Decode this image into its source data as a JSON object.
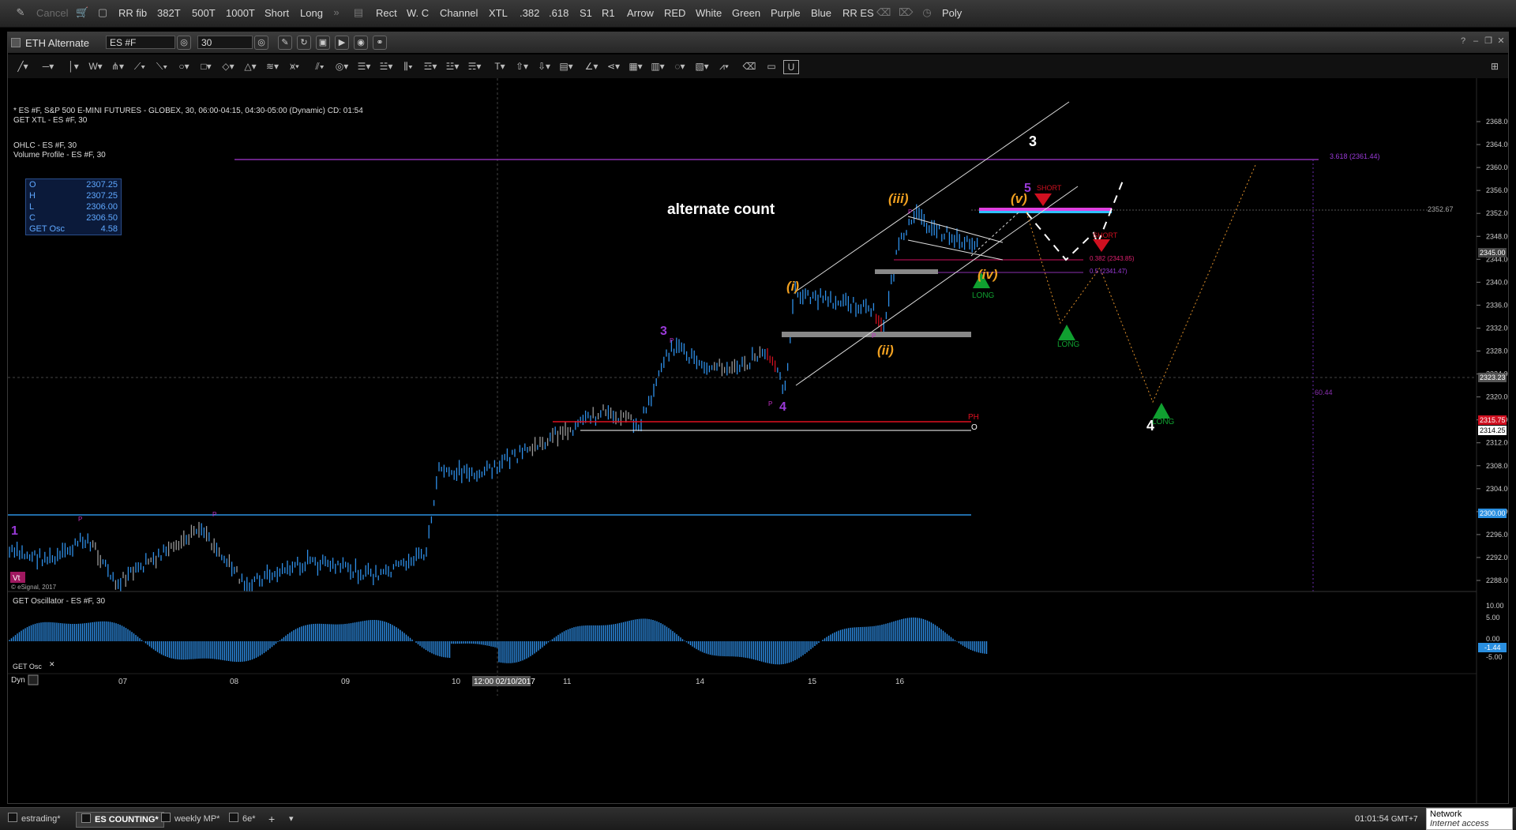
{
  "toolbar": {
    "items": [
      "Cancel",
      "RR fib",
      "382T",
      "500T",
      "1000T",
      "Short",
      "Long",
      "Rect",
      "W. C",
      "Channel",
      "XTL",
      ".382",
      ".618",
      "S1",
      "R1",
      "Arrow",
      "RED",
      "White",
      "Green",
      "Purple",
      "Blue",
      "RR ES",
      "Poly"
    ]
  },
  "window": {
    "title": "ETH Alternate",
    "symbol": "ES #F",
    "interval": "30"
  },
  "study_info": {
    "line1": "* ES #F, S&P 500 E-MINI FUTURES - GLOBEX, 30, 06:00-04:15, 04:30-05:00 (Dynamic) CD: 01:54",
    "line2": "GET XTL - ES #F, 30",
    "line3": "OHLC - ES #F, 30",
    "line4": "Volume Profile - ES #F, 30"
  },
  "ohlc": {
    "rows": [
      {
        "k": "O",
        "v": "2307.25"
      },
      {
        "k": "H",
        "v": "2307.25"
      },
      {
        "k": "L",
        "v": "2306.00"
      },
      {
        "k": "C",
        "v": "2306.50"
      },
      {
        "k": "GET Osc",
        "v": "4.58"
      }
    ]
  },
  "annotations": {
    "alternate_count": "alternate count",
    "wave_3_white": "3",
    "wave_4_white": "4",
    "wave_1_purple": "1",
    "wave_3_purple": "3",
    "wave_4_purple": "4",
    "wave_5_purple": "5",
    "wave_i": "(i)",
    "wave_ii": "(ii)",
    "wave_iii": "(iii)",
    "wave_iv": "(iv)",
    "wave_v": "(v)",
    "long1": "LONG",
    "long2": "LONG",
    "long3": "LONG",
    "short1": "SHORT",
    "short2": "SHORT",
    "fib_3618": "3.618 (2361.44)",
    "fib_0382": "0.382 (2343.85)",
    "fib_05": "0.5 (2341.47)",
    "level_235267": "2352.67",
    "label_6044": "60.44",
    "ph": "PH",
    "pl": "O",
    "p_marker": "P",
    "copyright": "© eSignal, 2017",
    "vt": "Vt"
  },
  "price_axis": {
    "ticks": [
      "2368.00",
      "2364.00",
      "2360.00",
      "2356.00",
      "2352.00",
      "2348.00",
      "2344.00",
      "2340.00",
      "2336.00",
      "2332.00",
      "2328.00",
      "2324.00",
      "2320.00",
      "2316.00",
      "2312.00",
      "2308.00",
      "2304.00",
      "2300.00",
      "2296.00",
      "2292.00",
      "2288.00"
    ],
    "badges": [
      {
        "text": "2345.00",
        "color": "#444"
      },
      {
        "text": "2323.23",
        "color": "#555"
      },
      {
        "text": "2315.75",
        "color": "#d01020"
      },
      {
        "text": "2314.25",
        "color": "#ffffff"
      },
      {
        "text": "2300.00",
        "color": "#2a8fe0"
      }
    ]
  },
  "oscillator": {
    "title": "GET Oscillator - ES #F, 30",
    "ticks": [
      "10.00",
      "5.00",
      "0.00",
      "-5.00"
    ],
    "badge": "-1.44"
  },
  "time_axis": {
    "labels": [
      "07",
      "08",
      "09",
      "10",
      "11",
      "14",
      "15",
      "16"
    ],
    "cursor_label": "12:00 02/10/2017"
  },
  "panel_footer": {
    "osc_label": "GET Osc",
    "dyn": "Dyn"
  },
  "tabs": [
    "estrading*",
    "ES COUNTING*",
    "weekly MP*",
    "6e*"
  ],
  "active_tab": "ES COUNTING*",
  "status": {
    "clock": "01:01:54",
    "tz": "GMT+7",
    "network_title": "Network",
    "network_sub": "Internet access"
  },
  "colors": {
    "bar_blue": "#2e8fe8",
    "bar_gray": "#9a9a9a",
    "purple": "#9a3ad8",
    "orange": "#f0a020",
    "green": "#10a030",
    "red": "#d01020"
  }
}
